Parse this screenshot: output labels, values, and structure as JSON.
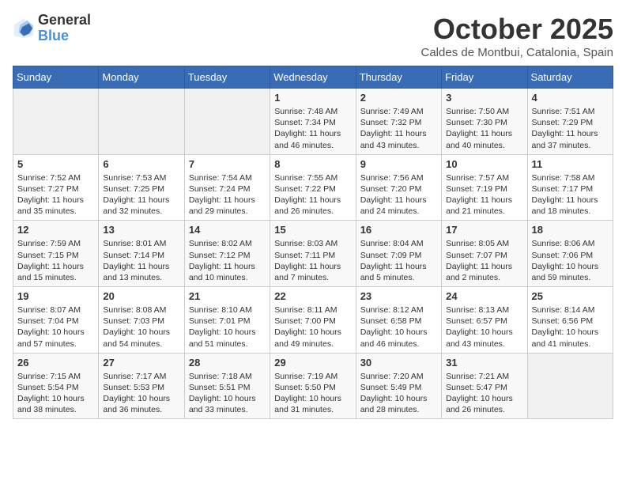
{
  "header": {
    "logo_general": "General",
    "logo_blue": "Blue",
    "month_title": "October 2025",
    "location": "Caldes de Montbui, Catalonia, Spain"
  },
  "weekdays": [
    "Sunday",
    "Monday",
    "Tuesday",
    "Wednesday",
    "Thursday",
    "Friday",
    "Saturday"
  ],
  "weeks": [
    [
      {
        "day": "",
        "info": ""
      },
      {
        "day": "",
        "info": ""
      },
      {
        "day": "",
        "info": ""
      },
      {
        "day": "1",
        "info": "Sunrise: 7:48 AM\nSunset: 7:34 PM\nDaylight: 11 hours and 46 minutes."
      },
      {
        "day": "2",
        "info": "Sunrise: 7:49 AM\nSunset: 7:32 PM\nDaylight: 11 hours and 43 minutes."
      },
      {
        "day": "3",
        "info": "Sunrise: 7:50 AM\nSunset: 7:30 PM\nDaylight: 11 hours and 40 minutes."
      },
      {
        "day": "4",
        "info": "Sunrise: 7:51 AM\nSunset: 7:29 PM\nDaylight: 11 hours and 37 minutes."
      }
    ],
    [
      {
        "day": "5",
        "info": "Sunrise: 7:52 AM\nSunset: 7:27 PM\nDaylight: 11 hours and 35 minutes."
      },
      {
        "day": "6",
        "info": "Sunrise: 7:53 AM\nSunset: 7:25 PM\nDaylight: 11 hours and 32 minutes."
      },
      {
        "day": "7",
        "info": "Sunrise: 7:54 AM\nSunset: 7:24 PM\nDaylight: 11 hours and 29 minutes."
      },
      {
        "day": "8",
        "info": "Sunrise: 7:55 AM\nSunset: 7:22 PM\nDaylight: 11 hours and 26 minutes."
      },
      {
        "day": "9",
        "info": "Sunrise: 7:56 AM\nSunset: 7:20 PM\nDaylight: 11 hours and 24 minutes."
      },
      {
        "day": "10",
        "info": "Sunrise: 7:57 AM\nSunset: 7:19 PM\nDaylight: 11 hours and 21 minutes."
      },
      {
        "day": "11",
        "info": "Sunrise: 7:58 AM\nSunset: 7:17 PM\nDaylight: 11 hours and 18 minutes."
      }
    ],
    [
      {
        "day": "12",
        "info": "Sunrise: 7:59 AM\nSunset: 7:15 PM\nDaylight: 11 hours and 15 minutes."
      },
      {
        "day": "13",
        "info": "Sunrise: 8:01 AM\nSunset: 7:14 PM\nDaylight: 11 hours and 13 minutes."
      },
      {
        "day": "14",
        "info": "Sunrise: 8:02 AM\nSunset: 7:12 PM\nDaylight: 11 hours and 10 minutes."
      },
      {
        "day": "15",
        "info": "Sunrise: 8:03 AM\nSunset: 7:11 PM\nDaylight: 11 hours and 7 minutes."
      },
      {
        "day": "16",
        "info": "Sunrise: 8:04 AM\nSunset: 7:09 PM\nDaylight: 11 hours and 5 minutes."
      },
      {
        "day": "17",
        "info": "Sunrise: 8:05 AM\nSunset: 7:07 PM\nDaylight: 11 hours and 2 minutes."
      },
      {
        "day": "18",
        "info": "Sunrise: 8:06 AM\nSunset: 7:06 PM\nDaylight: 10 hours and 59 minutes."
      }
    ],
    [
      {
        "day": "19",
        "info": "Sunrise: 8:07 AM\nSunset: 7:04 PM\nDaylight: 10 hours and 57 minutes."
      },
      {
        "day": "20",
        "info": "Sunrise: 8:08 AM\nSunset: 7:03 PM\nDaylight: 10 hours and 54 minutes."
      },
      {
        "day": "21",
        "info": "Sunrise: 8:10 AM\nSunset: 7:01 PM\nDaylight: 10 hours and 51 minutes."
      },
      {
        "day": "22",
        "info": "Sunrise: 8:11 AM\nSunset: 7:00 PM\nDaylight: 10 hours and 49 minutes."
      },
      {
        "day": "23",
        "info": "Sunrise: 8:12 AM\nSunset: 6:58 PM\nDaylight: 10 hours and 46 minutes."
      },
      {
        "day": "24",
        "info": "Sunrise: 8:13 AM\nSunset: 6:57 PM\nDaylight: 10 hours and 43 minutes."
      },
      {
        "day": "25",
        "info": "Sunrise: 8:14 AM\nSunset: 6:56 PM\nDaylight: 10 hours and 41 minutes."
      }
    ],
    [
      {
        "day": "26",
        "info": "Sunrise: 7:15 AM\nSunset: 5:54 PM\nDaylight: 10 hours and 38 minutes."
      },
      {
        "day": "27",
        "info": "Sunrise: 7:17 AM\nSunset: 5:53 PM\nDaylight: 10 hours and 36 minutes."
      },
      {
        "day": "28",
        "info": "Sunrise: 7:18 AM\nSunset: 5:51 PM\nDaylight: 10 hours and 33 minutes."
      },
      {
        "day": "29",
        "info": "Sunrise: 7:19 AM\nSunset: 5:50 PM\nDaylight: 10 hours and 31 minutes."
      },
      {
        "day": "30",
        "info": "Sunrise: 7:20 AM\nSunset: 5:49 PM\nDaylight: 10 hours and 28 minutes."
      },
      {
        "day": "31",
        "info": "Sunrise: 7:21 AM\nSunset: 5:47 PM\nDaylight: 10 hours and 26 minutes."
      },
      {
        "day": "",
        "info": ""
      }
    ]
  ]
}
